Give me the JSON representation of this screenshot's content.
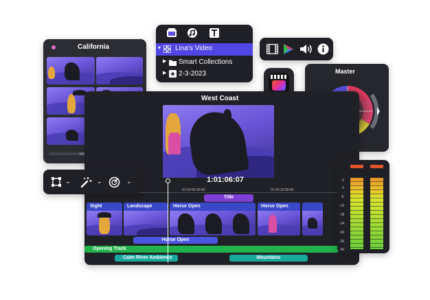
{
  "california": {
    "title": "California"
  },
  "library": {
    "items": [
      {
        "label": "Lina's Video",
        "selected": true
      },
      {
        "label": "Smart Collections",
        "selected": false
      },
      {
        "label": "2-3-2023",
        "selected": false
      }
    ]
  },
  "viewer": {
    "title": "West Coast",
    "timecode": "1:01:06:07"
  },
  "color": {
    "title": "Master"
  },
  "timeline": {
    "ruler": [
      "01:00:05:00:00",
      "01:00:10:00:00"
    ],
    "title_clip": "Title",
    "video_clips": [
      "Sight",
      "Landscape",
      "Horse Open",
      "Horse Open"
    ],
    "connected_clip": "Horse Open",
    "audio_clips": [
      "Opening Track",
      "Calm River Ambience",
      "Mountains"
    ]
  },
  "meter": {
    "scale": [
      "6",
      "0",
      "-6",
      "-12",
      "-18",
      "-24",
      "-30",
      "-36",
      "-42"
    ]
  },
  "colors": {
    "accent": "#5b4de0",
    "selected": "#4f46e5",
    "green": "#22b24c",
    "teal": "#1aa89b",
    "purple": "#7d3fd6",
    "blue": "#4a56e2"
  },
  "icons": {
    "browser_tabs": [
      "media-icon",
      "music-icon",
      "titles-icon"
    ],
    "toolbar": [
      "film-icon",
      "color-icon",
      "audio-icon",
      "info-icon"
    ],
    "tools": [
      "transform-icon",
      "magic-wand-icon",
      "speed-icon"
    ],
    "app": "final-cut-pro-icon"
  }
}
